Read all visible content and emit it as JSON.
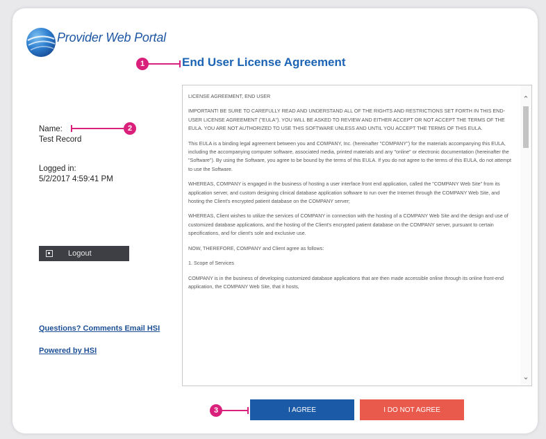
{
  "header": {
    "brand": "Provider Web Portal",
    "title": "End User License Agreement"
  },
  "callouts": [
    "1",
    "2",
    "3"
  ],
  "sidebar": {
    "name_label": "Name:",
    "name_value": "Test Record",
    "logged_in_label": "Logged in:",
    "logged_in_value": "5/2/2017 4:59:41 PM",
    "logout_label": "Logout",
    "questions_link": "Questions? Comments Email HSI",
    "powered_link": "Powered by HSI"
  },
  "eula": {
    "paragraphs": [
      "LICENSE AGREEMENT, END USER",
      "IMPORTANT! BE SURE TO CAREFULLY READ AND UNDERSTAND ALL OF THE RIGHTS AND RESTRICTIONS SET FORTH IN THIS END-USER LICENSE AGREEMENT (\"EULA\"). YOU WILL BE ASKED TO REVIEW AND EITHER ACCEPT OR NOT ACCEPT THE TERMS OF THE EULA. YOU ARE NOT AUTHORIZED TO USE THIS SOFTWARE UNLESS AND UNTIL YOU ACCEPT THE TERMS OF THIS EULA.",
      "This EULA is a binding legal agreement between you and COMPANY, Inc. (hereinafter \"COMPANY\") for the materials accompanying this EULA, including the accompanying computer software, associated media, printed materials and any \"online\" or electronic documentation (hereinafter the \"Software\"). By using the Software, you agree to be bound by the terms of this EULA. If you do not agree to the terms of this EULA, do not attempt to use the Software.",
      "WHEREAS, COMPANY is engaged in the business of hosting a user interface front end application, called the \"COMPANY Web Site\" from its application server, and custom designing clinical database application software to run over the Internet through the COMPANY Web Site, and hosting the Client's encrypted patient database on the COMPANY server;",
      "WHEREAS, Client wishes to utilize the services of COMPANY in connection with the hosting of a COMPANY Web Site and the design and use of customized database applications, and the hosting of the Client's encrypted patient database on the COMPANY server, pursuant to certain specifications, and for client's sole and exclusive use.",
      "NOW, THEREFORE, COMPANY and Client agree as follows:",
      "1. Scope of Services",
      "COMPANY is in the business of developing customized database applications that are then made accessible online through its online front-end application, the COMPANY Web Site, that it hosts,"
    ]
  },
  "actions": {
    "agree_label": "I AGREE",
    "disagree_label": "I DO NOT AGREE"
  },
  "colors": {
    "brand_blue": "#1b5aa6",
    "callout_magenta": "#d9207a",
    "decline_red": "#ea5a4c",
    "logout_dark": "#3d3f44"
  }
}
